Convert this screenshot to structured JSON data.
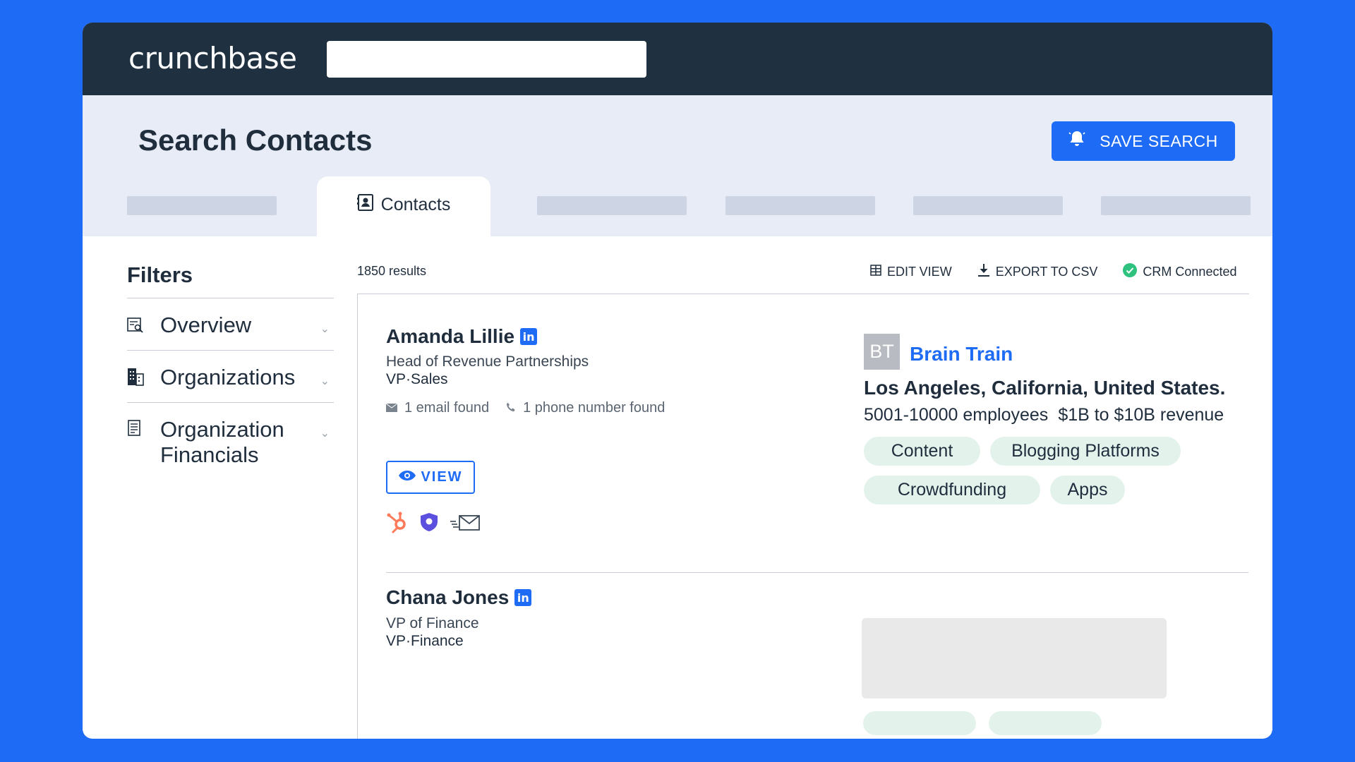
{
  "app": {
    "logo_text": "crunchbase",
    "search_placeholder": ""
  },
  "header": {
    "title": "Search Contacts",
    "save_search_label": "SAVE SEARCH",
    "active_tab_label": "Contacts"
  },
  "filters": {
    "title": "Filters",
    "items": [
      {
        "label": "Overview",
        "icon": "overview-icon"
      },
      {
        "label": "Organizations",
        "icon": "building-icon"
      },
      {
        "label": "Organization Financials",
        "icon": "document-icon"
      }
    ]
  },
  "results": {
    "count_label": "1850 results",
    "edit_view_label": "EDIT VIEW",
    "export_label": "EXPORT TO CSV",
    "crm_label": "CRM Connected"
  },
  "contacts": [
    {
      "name": "Amanda Lillie",
      "title": "Head of Revenue Partnerships",
      "level": "VP",
      "department": "Sales",
      "email_found": "1 email found",
      "phone_found": "1 phone number found",
      "view_label": "VIEW",
      "org": {
        "initials": "BT",
        "name": "Brain Train",
        "location": "Los Angeles, California, United States.",
        "employees": "5001-10000 employees",
        "revenue": "$1B to $10B revenue",
        "tags": [
          "Content",
          "Blogging Platforms",
          "Crowdfunding",
          "Apps"
        ]
      }
    },
    {
      "name": "Chana Jones",
      "title": "VP of Finance",
      "level": "VP",
      "department": "Finance"
    }
  ],
  "colors": {
    "brand_blue": "#1e6cf5",
    "topbar": "#1f3040",
    "header_bg": "#e8ecf6",
    "tag_bg": "#e3f3ec",
    "crm_green": "#2ec27e",
    "hubspot_orange": "#ff7a59",
    "shield_purple": "#5b4fe0"
  }
}
